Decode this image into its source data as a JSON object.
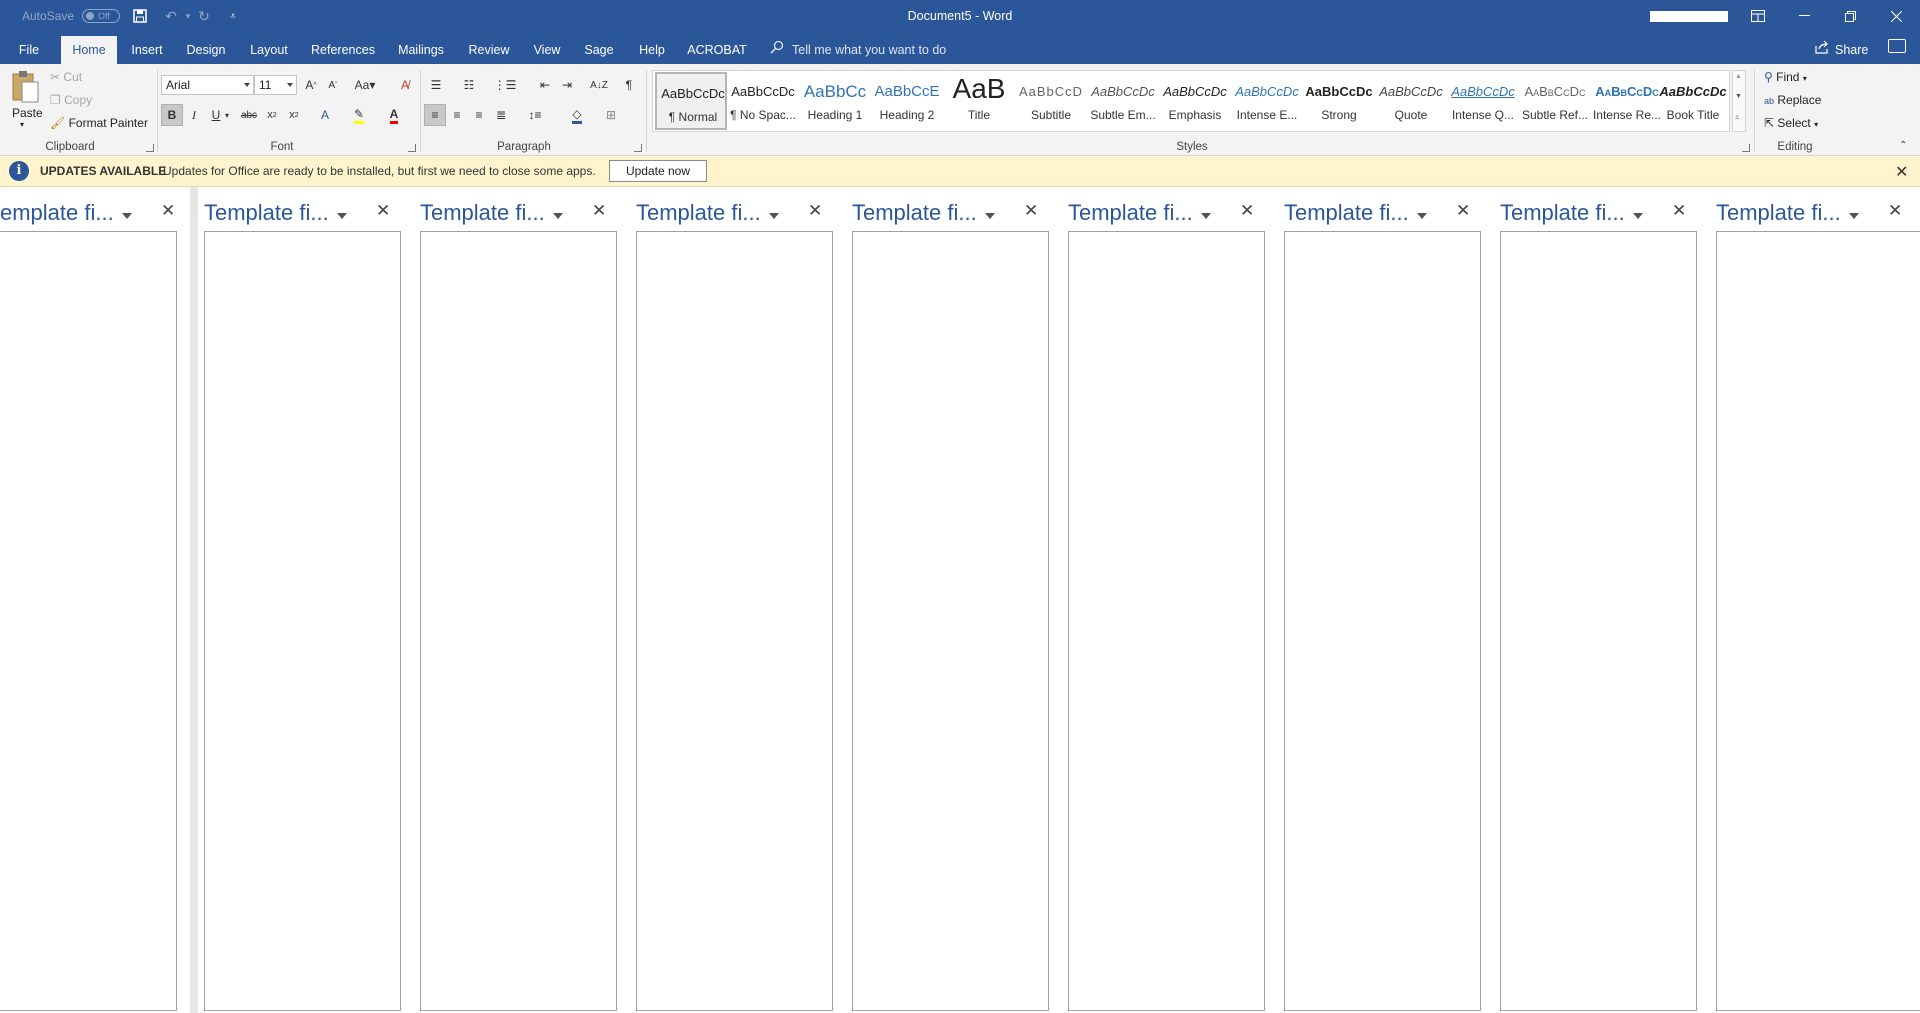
{
  "titlebar": {
    "autosave_label": "AutoSave",
    "autosave_state": "Off",
    "document": "Document5",
    "separator": "-",
    "app": "Word"
  },
  "tabs": [
    {
      "label": "File"
    },
    {
      "label": "Home"
    },
    {
      "label": "Insert"
    },
    {
      "label": "Design"
    },
    {
      "label": "Layout"
    },
    {
      "label": "References"
    },
    {
      "label": "Mailings"
    },
    {
      "label": "Review"
    },
    {
      "label": "View"
    },
    {
      "label": "Sage"
    },
    {
      "label": "Help"
    },
    {
      "label": "ACROBAT"
    }
  ],
  "active_tab": "Home",
  "tell_me": "Tell me what you want to do",
  "share_label": "Share",
  "clipboard": {
    "paste": "Paste",
    "cut": "Cut",
    "copy": "Copy",
    "format_painter": "Format Painter",
    "group": "Clipboard"
  },
  "font": {
    "name": "Arial",
    "size": "11",
    "group": "Font"
  },
  "paragraph": {
    "group": "Paragraph"
  },
  "styles": {
    "group": "Styles",
    "items": [
      {
        "sample": "AaBbCcDc",
        "name": "¶ Normal"
      },
      {
        "sample": "AaBbCcDc",
        "name": "¶ No Spac..."
      },
      {
        "sample": "AaBbCc",
        "name": "Heading 1"
      },
      {
        "sample": "AaBbCcE",
        "name": "Heading 2"
      },
      {
        "sample": "AaB",
        "name": "Title"
      },
      {
        "sample": "AaBbCcD",
        "name": "Subtitle"
      },
      {
        "sample": "AaBbCcDc",
        "name": "Subtle Em..."
      },
      {
        "sample": "AaBbCcDc",
        "name": "Emphasis"
      },
      {
        "sample": "AaBbCcDc",
        "name": "Intense E..."
      },
      {
        "sample": "AaBbCcDc",
        "name": "Strong"
      },
      {
        "sample": "AaBbCcDc",
        "name": "Quote"
      },
      {
        "sample": "AaBbCcDc",
        "name": "Intense Q..."
      },
      {
        "sample": "AaBbCcDc",
        "name": "Subtle Ref..."
      },
      {
        "sample": "AaBbCcDc",
        "name": "Intense Re..."
      },
      {
        "sample": "AaBbCcDc",
        "name": "Book Title"
      }
    ]
  },
  "editing": {
    "find": "Find",
    "replace": "Replace",
    "select": "Select",
    "group": "Editing"
  },
  "infobar": {
    "title": "UPDATES AVAILABLE",
    "message": "Updates for Office are ready to be installed, but first we need to close some apps.",
    "button": "Update now"
  },
  "panes": [
    {
      "title": "emplate fi..."
    },
    {
      "title": "Template fi..."
    },
    {
      "title": "Template fi..."
    },
    {
      "title": "Template fi..."
    },
    {
      "title": "Template fi..."
    },
    {
      "title": "Template fi..."
    },
    {
      "title": "Template fi..."
    },
    {
      "title": "Template fi..."
    },
    {
      "title": "Template fi..."
    }
  ],
  "colors": {
    "brand": "#2b579a",
    "infobar": "#fff4ce",
    "ribbon": "#f3f3f3"
  }
}
